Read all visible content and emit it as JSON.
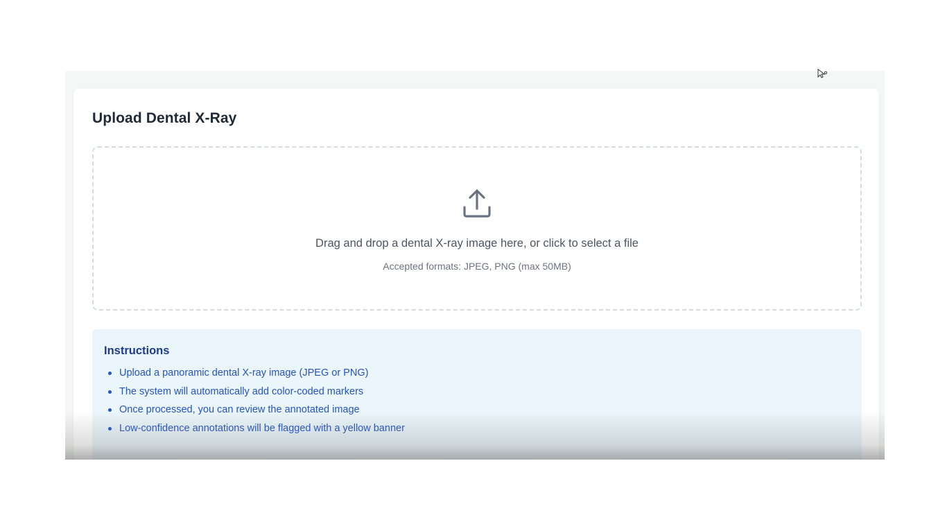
{
  "upload_card": {
    "title": "Upload Dental X-Ray",
    "dropzone": {
      "icon": "upload-icon",
      "primary_text": "Drag and drop a dental X-ray image here, or click to select a file",
      "secondary_text": "Accepted formats: JPEG, PNG (max 50MB)"
    }
  },
  "instructions": {
    "title": "Instructions",
    "items": [
      "Upload a panoramic dental X-ray image (JPEG or PNG)",
      "The system will automatically add color-coded markers",
      "Once processed, you can review the annotated image",
      "Low-confidence annotations will be flagged with a yellow banner"
    ]
  },
  "colors": {
    "title_text": "#1f2a37",
    "instructions_bg": "#eaf6fb",
    "instructions_text": "#2552c5",
    "instructions_title": "#1e3a8a",
    "dropzone_border": "#d5dbe1",
    "icon": "#6b7280"
  }
}
